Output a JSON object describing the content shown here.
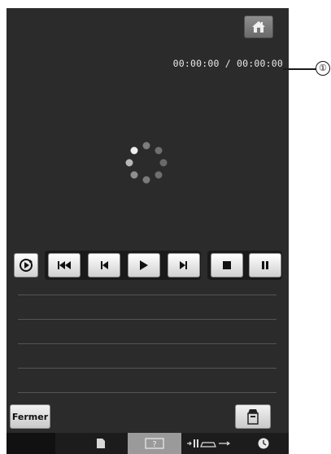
{
  "player": {
    "time_display": "00:00:00 / 00:00:00",
    "close_label": "Fermer"
  },
  "callout": {
    "number": "①"
  },
  "icons": {
    "home": "home-icon",
    "repeat": "repeat-icon",
    "skip_start": "skip-to-start-icon",
    "previous": "previous-icon",
    "play": "play-icon",
    "next": "next-icon",
    "stop": "stop-icon",
    "pause": "pause-icon",
    "loading": "loading-spinner-icon",
    "device": "device-icon",
    "tab_document": "document-icon",
    "tab_help": "help-icon",
    "tab_sewing": "sewing-width-icon",
    "tab_clock": "clock-icon"
  },
  "colors": {
    "screen_bg": "#2b2b2b",
    "active_tab": "#9a9a9a"
  }
}
